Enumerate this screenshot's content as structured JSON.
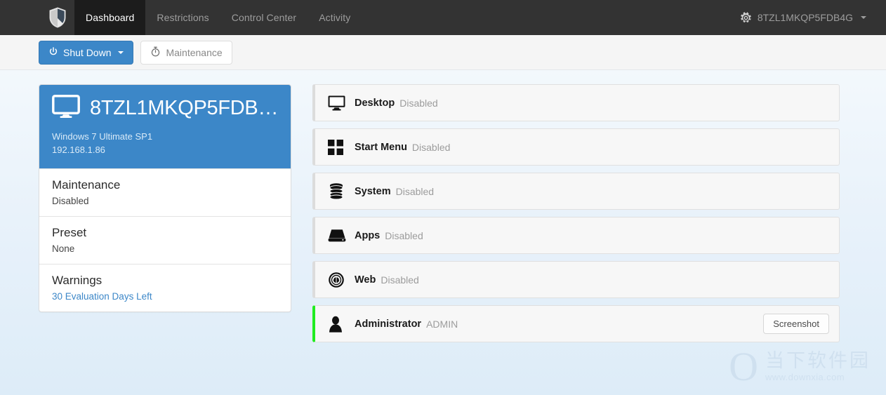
{
  "navbar": {
    "logo_icon": "shield-icon",
    "tabs": [
      {
        "label": "Dashboard",
        "active": true
      },
      {
        "label": "Restrictions",
        "active": false
      },
      {
        "label": "Control Center",
        "active": false
      },
      {
        "label": "Activity",
        "active": false
      }
    ],
    "account": {
      "icon": "gear-icon",
      "label": "8TZL1MKQP5FDB4G",
      "caret": "chevron-down-icon"
    }
  },
  "toolbar": {
    "shutdown_label": "Shut Down",
    "shutdown_icon": "power-icon",
    "maintenance_label": "Maintenance",
    "maintenance_icon": "stopwatch-icon"
  },
  "device_panel": {
    "icon": "monitor-icon",
    "title": "8TZL1MKQP5FDB…",
    "os": "Windows 7 Ultimate SP1",
    "ip": "192.168.1.86",
    "rows": [
      {
        "label": "Maintenance",
        "value": "Disabled",
        "is_link": false
      },
      {
        "label": "Preset",
        "value": "None",
        "is_link": false
      },
      {
        "label": "Warnings",
        "value": "30 Evaluation Days Left",
        "is_link": true
      }
    ]
  },
  "features": [
    {
      "icon": "monitor-icon",
      "name": "Desktop",
      "state": "Disabled",
      "accent": "#dcdcdc",
      "action": null
    },
    {
      "icon": "windows-icon",
      "name": "Start Menu",
      "state": "Disabled",
      "accent": "#dcdcdc",
      "action": null
    },
    {
      "icon": "server-icon",
      "name": "System",
      "state": "Disabled",
      "accent": "#dcdcdc",
      "action": null
    },
    {
      "icon": "hdd-icon",
      "name": "Apps",
      "state": "Disabled",
      "accent": "#dcdcdc",
      "action": null
    },
    {
      "icon": "globe-icon",
      "name": "Web",
      "state": "Disabled",
      "accent": "#dcdcdc",
      "action": null
    },
    {
      "icon": "user-icon",
      "name": "Administrator",
      "state": "ADMIN",
      "accent": "#21ec21",
      "action": "Screenshot"
    }
  ],
  "watermark": {
    "glyph": "O",
    "cn_text": "当下软件园",
    "url": "www.downxia.com"
  },
  "colors": {
    "navbar_bg": "#333333",
    "navbar_active_bg": "#1c1c1c",
    "primary": "#3c87c8",
    "accent_green": "#21ec21",
    "page_bg_top": "#f8fbfe",
    "page_bg_bottom": "#ddecf8"
  }
}
